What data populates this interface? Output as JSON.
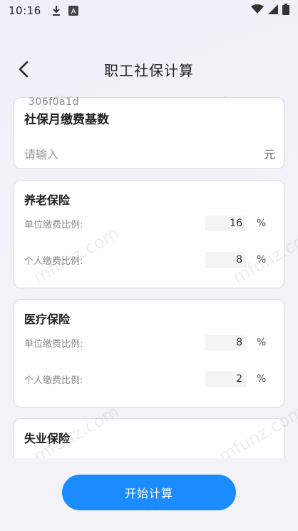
{
  "status_bar": {
    "time": "10:16"
  },
  "nav": {
    "title": "职工社保计算"
  },
  "base_card": {
    "id_tag": "306f0a1d",
    "heading": "社保月缴费基数",
    "input_placeholder": "请输入",
    "unit": "元"
  },
  "sections": [
    {
      "heading": "养老保险",
      "rows": [
        {
          "label": "单位缴费比例:",
          "value": "16",
          "unit": "%"
        },
        {
          "label": "个人缴费比例:",
          "value": "8",
          "unit": "%"
        }
      ]
    },
    {
      "heading": "医疗保险",
      "rows": [
        {
          "label": "单位缴费比例:",
          "value": "8",
          "unit": "%"
        },
        {
          "label": "个人缴费比例:",
          "value": "2",
          "unit": "%"
        }
      ]
    },
    {
      "heading": "失业保险"
    }
  ],
  "watermark": "mfunz.com",
  "action": {
    "start_label": "开始计算"
  },
  "colors": {
    "accent": "#1a8cff"
  }
}
